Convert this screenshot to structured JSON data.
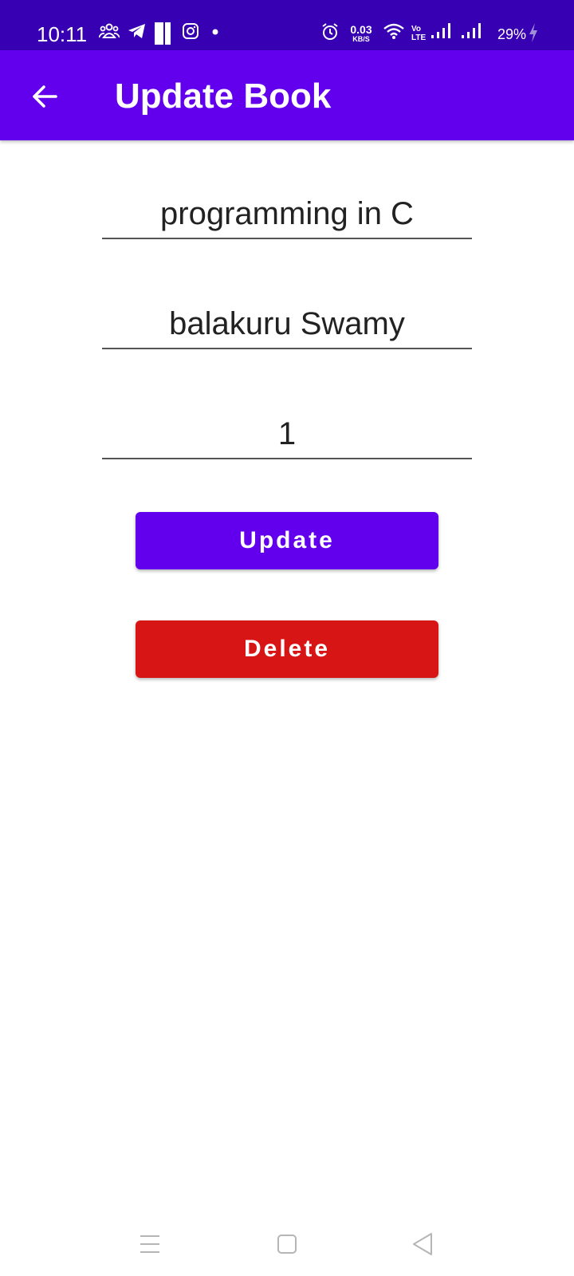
{
  "status_bar": {
    "time": "10:11",
    "net_speed_value": "0.03",
    "net_speed_unit": "KB/S",
    "volte_line1": "Vo",
    "volte_line2": "LTE",
    "battery": "29%",
    "colors": {
      "background": "#3700b3"
    }
  },
  "app_bar": {
    "title": "Update Book",
    "back_icon": "arrow-back-icon",
    "colors": {
      "background": "#6200ee"
    }
  },
  "form": {
    "title_value": "programming in C",
    "author_value": "balakuru Swamy",
    "quantity_value": "1"
  },
  "actions": {
    "update_label": "Update",
    "delete_label": "Delete",
    "colors": {
      "update": "#6200ee",
      "delete": "#d81515"
    }
  },
  "nav_bar": {
    "icons": [
      "menu-icon",
      "home-square-icon",
      "back-triangle-icon"
    ]
  }
}
